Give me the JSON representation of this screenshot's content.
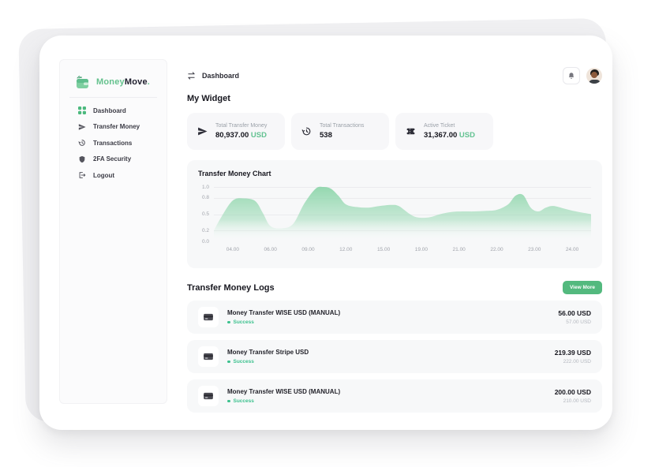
{
  "logo": {
    "part1": "Money",
    "part2": "Move",
    "suffix": "."
  },
  "header": {
    "breadcrumb_label": "Dashboard"
  },
  "sidebar": {
    "items": [
      {
        "label": "Dashboard"
      },
      {
        "label": "Transfer Money"
      },
      {
        "label": "Transactions"
      },
      {
        "label": "2FA Security"
      },
      {
        "label": "Logout"
      }
    ]
  },
  "widgets": {
    "section_title": "My Widget",
    "cards": [
      {
        "label": "Total Transfer Money",
        "value": "80,937.00",
        "currency": "USD"
      },
      {
        "label": "Total Transactions",
        "value": "538",
        "currency": ""
      },
      {
        "label": "Active Ticket",
        "value": "31,367.00",
        "currency": "USD"
      }
    ]
  },
  "chart_data": {
    "type": "area",
    "title": "Transfer Money Chart",
    "x_labels": [
      "04.00",
      "06.00",
      "09.00",
      "12.00",
      "15.00",
      "19.00",
      "21.00",
      "22.00",
      "23.00",
      "24.00"
    ],
    "y_tick_labels": [
      "1.0",
      "0.8",
      "0.5",
      "0.2",
      "0.0"
    ],
    "ylim": [
      0.0,
      1.05
    ],
    "grid": true,
    "legend": false,
    "series": [
      {
        "name": "Transfer Money",
        "points": [
          [
            0,
            0.2
          ],
          [
            2,
            0.45
          ],
          [
            5,
            0.75
          ],
          [
            8,
            0.79
          ],
          [
            11,
            0.74
          ],
          [
            13,
            0.52
          ],
          [
            15,
            0.28
          ],
          [
            18,
            0.24
          ],
          [
            21,
            0.32
          ],
          [
            24,
            0.7
          ],
          [
            27,
            0.97
          ],
          [
            29,
            1.0
          ],
          [
            31,
            0.97
          ],
          [
            33,
            0.84
          ],
          [
            35,
            0.68
          ],
          [
            38,
            0.63
          ],
          [
            41,
            0.62
          ],
          [
            44,
            0.65
          ],
          [
            47,
            0.67
          ],
          [
            49,
            0.65
          ],
          [
            52,
            0.5
          ],
          [
            54,
            0.44
          ],
          [
            57,
            0.44
          ],
          [
            60,
            0.5
          ],
          [
            63,
            0.54
          ],
          [
            66,
            0.55
          ],
          [
            69,
            0.55
          ],
          [
            72,
            0.56
          ],
          [
            75,
            0.58
          ],
          [
            78,
            0.68
          ],
          [
            80,
            0.84
          ],
          [
            82,
            0.85
          ],
          [
            84,
            0.62
          ],
          [
            86,
            0.55
          ],
          [
            88,
            0.62
          ],
          [
            90,
            0.65
          ],
          [
            93,
            0.6
          ],
          [
            96,
            0.55
          ],
          [
            100,
            0.5
          ]
        ]
      }
    ],
    "colors": {
      "fill_top": "#8FD6AC",
      "fill_bottom": "#FFFFFF"
    }
  },
  "logs": {
    "section_title": "Transfer Money Logs",
    "view_more_label": "View More",
    "rows": [
      {
        "title": "Money Transfer WISE USD (MANUAL)",
        "status": "Success",
        "amount": "56.00 USD",
        "sub_amount": "57.00 USD"
      },
      {
        "title": "Money Transfer Stripe USD",
        "status": "Success",
        "amount": "219.39 USD",
        "sub_amount": "222.00 USD"
      },
      {
        "title": "Money Transfer WISE USD (MANUAL)",
        "status": "Success",
        "amount": "200.00 USD",
        "sub_amount": "210.00 USD"
      }
    ]
  }
}
